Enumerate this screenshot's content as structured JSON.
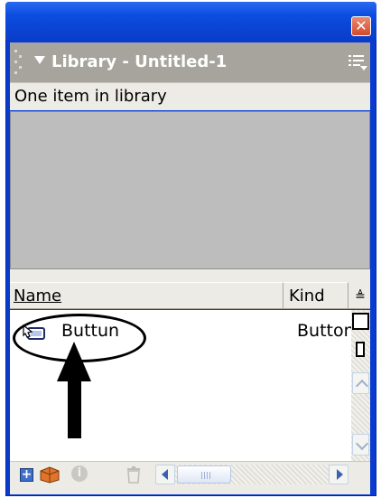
{
  "window": {
    "close_icon": "close-icon"
  },
  "panel": {
    "title": "Library - Untitled-1",
    "collapse_icon": "triangle-down-icon",
    "options_icon": "options-menu-icon"
  },
  "status": {
    "item_count_text": "One item in library"
  },
  "list": {
    "columns": [
      {
        "label": "Name"
      },
      {
        "label": "Kind"
      }
    ],
    "sort_icon": "sort-order-icon",
    "items": [
      {
        "name": "Buttun",
        "kind": "Button",
        "icon": "button-symbol-icon"
      }
    ]
  },
  "view_buttons": {
    "wide": "wide-state-icon",
    "narrow": "narrow-state-icon"
  },
  "toolbar": {
    "buttons": [
      {
        "icon": "new-symbol-icon"
      },
      {
        "icon": "new-folder-icon"
      },
      {
        "icon": "properties-icon"
      },
      {
        "icon": "delete-icon"
      }
    ]
  },
  "annotation": {
    "shape": "ellipse-with-arrow"
  }
}
